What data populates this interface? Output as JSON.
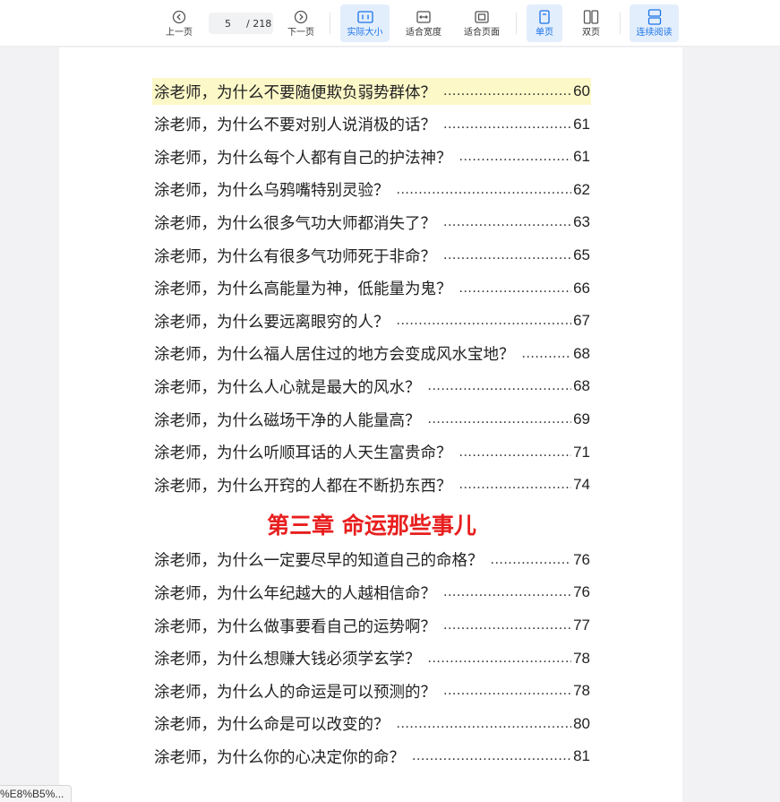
{
  "toolbar": {
    "prev_label": "上一页",
    "next_label": "下一页",
    "current_page": "5",
    "total_pages": "/ 218",
    "actual_size_label": "实际大小",
    "fit_width_label": "适合宽度",
    "fit_page_label": "适合页面",
    "single_page_label": "单页",
    "double_page_label": "双页",
    "continuous_label": "连续阅读",
    "accent_color": "#1a73e8"
  },
  "toc": {
    "entries_before": [
      {
        "title": "涂老师，为什么不要随便欺负弱势群体？",
        "page": "60"
      },
      {
        "title": "涂老师，为什么不要对别人说消极的话？",
        "page": "61"
      },
      {
        "title": "涂老师，为什么每个人都有自己的护法神？",
        "page": "61"
      },
      {
        "title": "涂老师，为什么乌鸦嘴特别灵验？",
        "page": "62"
      },
      {
        "title": "涂老师，为什么很多气功大师都消失了？",
        "page": "63"
      },
      {
        "title": "涂老师，为什么有很多气功师死于非命？",
        "page": "65"
      },
      {
        "title": "涂老师，为什么高能量为神，低能量为鬼？",
        "page": "66"
      },
      {
        "title": "涂老师，为什么要远离眼穷的人？",
        "page": "67"
      },
      {
        "title": "涂老师，为什么福人居住过的地方会变成风水宝地？",
        "page": "68"
      },
      {
        "title": "涂老师，为什么人心就是最大的风水？",
        "page": "68"
      },
      {
        "title": "涂老师，为什么磁场干净的人能量高？",
        "page": "69"
      },
      {
        "title": "涂老师，为什么听顺耳话的人天生富贵命？",
        "page": "71"
      },
      {
        "title": "涂老师，为什么开窍的人都在不断扔东西？",
        "page": "74"
      }
    ],
    "chapter_title": "第三章  命运那些事儿",
    "chapter_color": "#e81e1e",
    "entries_after": [
      {
        "title": "涂老师，为什么一定要尽早的知道自己的命格？",
        "page": "76"
      },
      {
        "title": "涂老师，为什么年纪越大的人越相信命？",
        "page": "76"
      },
      {
        "title": "涂老师，为什么做事要看自己的运势啊？",
        "page": "77"
      },
      {
        "title": "涂老师，为什么想赚大钱必须学玄学？",
        "page": "78"
      },
      {
        "title": "涂老师，为什么人的命运是可以预测的？",
        "page": "78"
      },
      {
        "title": "涂老师，为什么命是可以改变的？",
        "page": "80"
      },
      {
        "title": "涂老师，为什么你的心决定你的命？",
        "page": "81"
      }
    ],
    "highlight_color": "#fcf8c8"
  },
  "status": {
    "url_fragment": "%E8%B5%..."
  }
}
